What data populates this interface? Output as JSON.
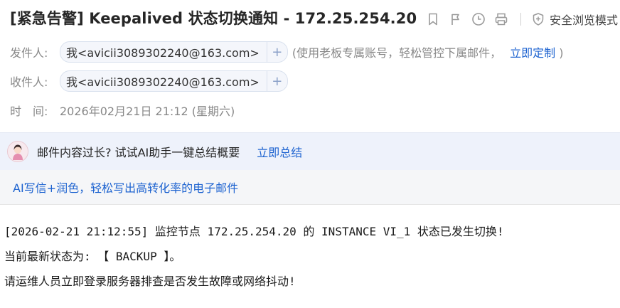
{
  "email": {
    "subject": "[紧急告警] Keepalived 状态切换通知 - 172.25.254.20",
    "toolbar": {
      "icons": [
        "bookmark-icon",
        "flag-icon",
        "clock-icon",
        "print-icon"
      ],
      "safe_browse_label": "安全浏览模式"
    },
    "from": {
      "label": "发件人:",
      "address": "我<avicii3089302240@163.com>",
      "plus": "+",
      "promo_text": "(使用老板专属账号，轻松管控下属邮件，",
      "promo_link": "立即定制",
      "promo_close": ")"
    },
    "to": {
      "label": "收件人:",
      "address": "我<avicii3089302240@163.com>",
      "plus": "+"
    },
    "time": {
      "label": "时　间:",
      "value": "2026年02月21日 21:12 (星期六)"
    },
    "ai_summary": {
      "text": "邮件内容过长? 试试AI助手一键总结概要",
      "link": "立即总结"
    },
    "ai_write": {
      "link": "AI写信+润色，轻松写出高转化率的电子邮件"
    },
    "body_lines": [
      "[2026-02-21 21:12:55] 监控节点 172.25.254.20 的 INSTANCE VI_1 状态已发生切换!",
      "当前最新状态为: 【 BACKUP 】。",
      "请运维人员立即登录服务器排查是否发生故障或网络抖动!"
    ]
  }
}
